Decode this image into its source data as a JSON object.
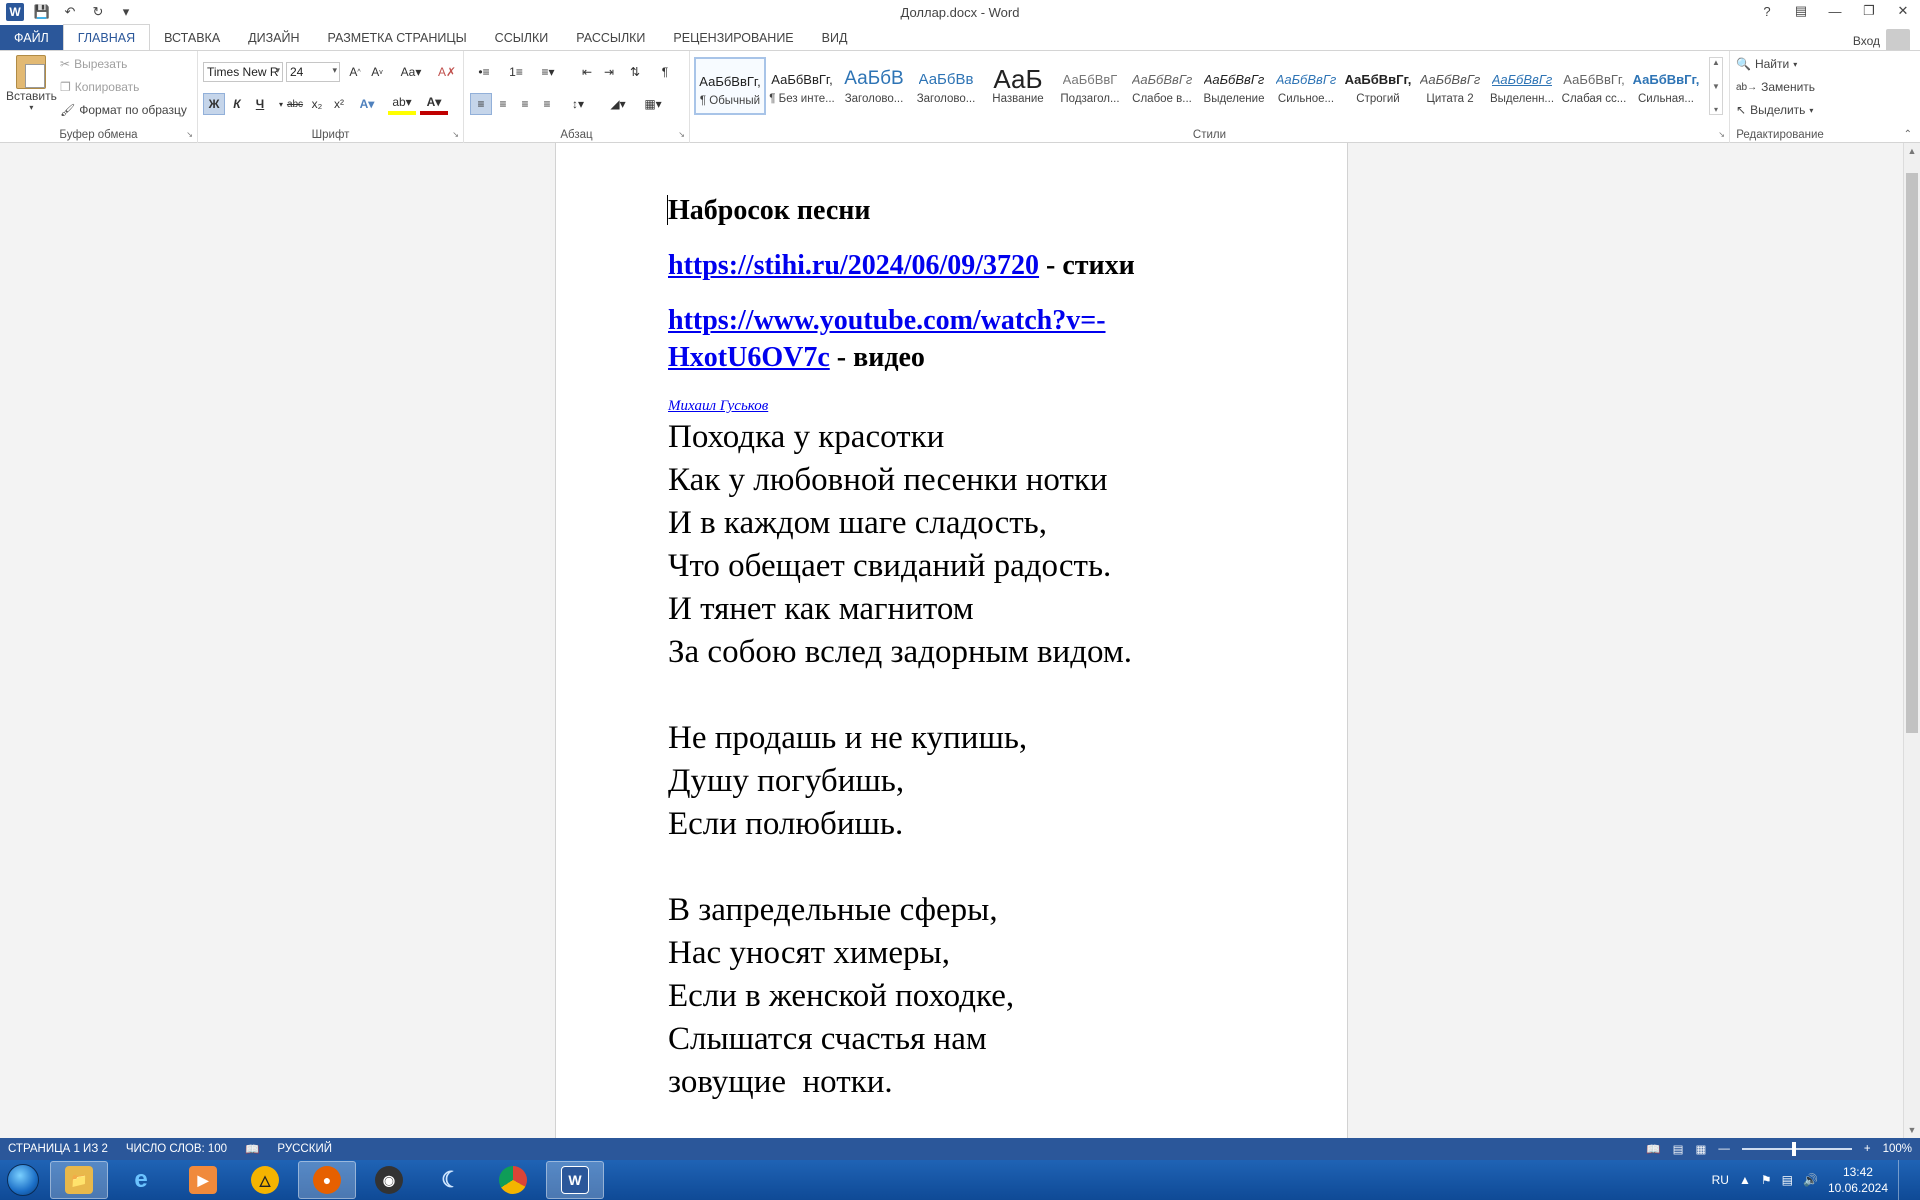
{
  "window": {
    "title": "Доллар.docx - Word",
    "signin": "Вход"
  },
  "tabs": [
    "ФАЙЛ",
    "ГЛАВНАЯ",
    "ВСТАВКА",
    "ДИЗАЙН",
    "РАЗМЕТКА СТРАНИЦЫ",
    "ССЫЛКИ",
    "РАССЫЛКИ",
    "РЕЦЕНЗИРОВАНИЕ",
    "ВИД"
  ],
  "ribbon": {
    "clipboard": {
      "paste": "Вставить",
      "cut": "Вырезать",
      "copy": "Копировать",
      "format_painter": "Формат по образцу",
      "label": "Буфер обмена"
    },
    "font": {
      "name": "Times New R",
      "size": "24",
      "case": "Aa",
      "bold": "Ж",
      "italic": "К",
      "underline": "Ч",
      "strike": "abc",
      "sub": "x₂",
      "sup": "x²",
      "label": "Шрифт"
    },
    "paragraph": {
      "label": "Абзац"
    },
    "styles": {
      "label": "Стили",
      "items": [
        {
          "sample": "АаБбВвГг,",
          "name": "¶ Обычный"
        },
        {
          "sample": "АаБбВвГг,",
          "name": "¶ Без инте..."
        },
        {
          "sample": "АаБбВ",
          "name": "Заголово..."
        },
        {
          "sample": "АаБбВв",
          "name": "Заголово..."
        },
        {
          "sample": "АаБ",
          "name": "Название"
        },
        {
          "sample": "АаБбВвГ",
          "name": "Подзагол..."
        },
        {
          "sample": "АаБбВвГг",
          "name": "Слабое в..."
        },
        {
          "sample": "АаБбВвГг",
          "name": "Выделение"
        },
        {
          "sample": "АаБбВвГг",
          "name": "Сильное..."
        },
        {
          "sample": "АаБбВвГг,",
          "name": "Строгий"
        },
        {
          "sample": "АаБбВвГг",
          "name": "Цитата 2"
        },
        {
          "sample": "АаБбВвГг",
          "name": "Выделенн..."
        },
        {
          "sample": "АаБбВвГг,",
          "name": "Слабая сс..."
        },
        {
          "sample": "АаБбВвГг,",
          "name": "Сильная..."
        }
      ]
    },
    "editing": {
      "find": "Найти",
      "replace": "Заменить",
      "select": "Выделить",
      "label": "Редактирование"
    }
  },
  "document": {
    "heading": "Набросок песни",
    "link1": "https://stihi.ru/2024/06/09/3720",
    "link1_suffix": " - стихи",
    "link2_part1": "https://www.youtube.com/watch?v=-",
    "link2_part2": "HxotU6OV7c",
    "link2_suffix": " - видео",
    "author": "Михаил Гуськов",
    "stanzas": [
      [
        "Походка у красотки",
        "Как у любовной песенки нотки",
        "И в каждом шаге сладость,",
        "Что обещает свиданий радость.",
        "И тянет как магнитом",
        "За собою вслед задорным видом."
      ],
      [
        "Не продашь и не купишь,",
        "Душу погубишь,",
        "Если полюбишь."
      ],
      [
        "В запредельные сферы,",
        "Нас уносят химеры,",
        "Если в женской походке,",
        "Слышатся счастья нам",
        "зовущие  нотки."
      ]
    ]
  },
  "statusbar": {
    "page": "СТРАНИЦА 1 ИЗ 2",
    "words": "ЧИСЛО СЛОВ: 100",
    "language": "РУССКИЙ",
    "zoom": "100%"
  },
  "taskbar": {
    "lang": "RU",
    "time": "13:42",
    "date": "10.06.2024"
  },
  "colors": {
    "accent": "#2b579a",
    "link": "#0000ee"
  }
}
